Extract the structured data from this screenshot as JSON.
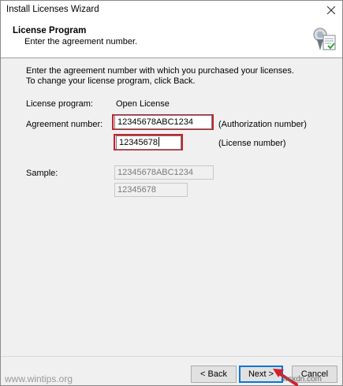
{
  "window": {
    "title": "Install Licenses Wizard"
  },
  "header": {
    "title": "License Program",
    "subtitle": "Enter the agreement number."
  },
  "intro": "Enter the agreement number with which you purchased your licenses. To change your license program, click Back.",
  "license_program": {
    "label": "License program:",
    "value": "Open License"
  },
  "agreement": {
    "label": "Agreement number:",
    "authorization_value": "12345678ABC1234",
    "authorization_hint": "(Authorization number)",
    "license_value": "12345678",
    "license_hint": "(License number)"
  },
  "sample": {
    "label": "Sample:",
    "authorization": "12345678ABC1234",
    "license": "12345678"
  },
  "buttons": {
    "back": "< Back",
    "next": "Next >",
    "cancel": "Cancel"
  },
  "watermark": {
    "left": "www.wintips.org",
    "right": "wsxdn.com"
  },
  "colors": {
    "highlight": "#c8202e",
    "default_button": "#0078d7"
  }
}
